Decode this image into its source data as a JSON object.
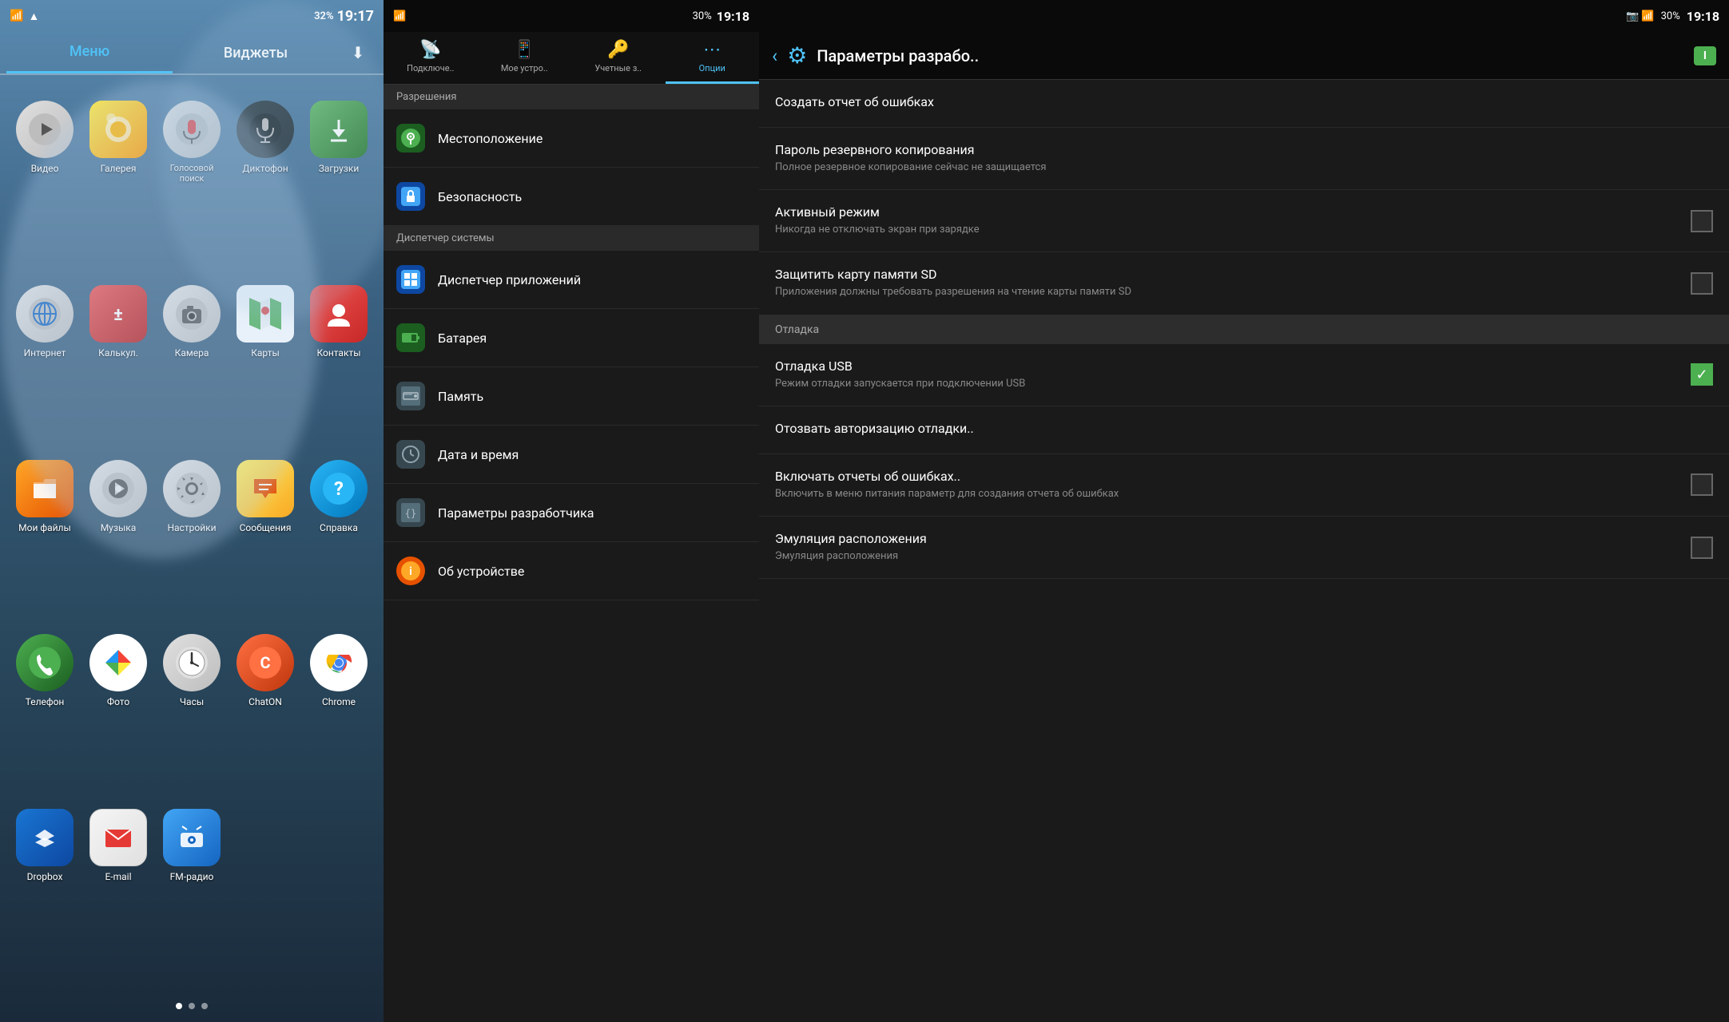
{
  "home": {
    "status_bar": {
      "left": "📶",
      "battery": "32%",
      "time": "19:17"
    },
    "tabs": [
      {
        "label": "Меню",
        "active": true
      },
      {
        "label": "Виджеты",
        "active": false
      }
    ],
    "download_icon": "⬇",
    "apps": [
      {
        "id": "video",
        "label": "Видео",
        "icon": "▶",
        "color": "#bdbdbd",
        "text_color": "#333"
      },
      {
        "id": "gallery",
        "label": "Галерея",
        "icon": "🌼",
        "color": "#ff9800"
      },
      {
        "id": "voice",
        "label": "Голосовой поиск",
        "icon": "🎤",
        "color": "#bdbdbd",
        "text_color": "#333"
      },
      {
        "id": "dictophone",
        "label": "Диктофон",
        "icon": "🎙",
        "color": "#37474f"
      },
      {
        "id": "downloads",
        "label": "Загрузки",
        "icon": "⬇",
        "color": "#4caf50"
      },
      {
        "id": "internet",
        "label": "Интернет",
        "icon": "🌐",
        "color": "#bdbdbd"
      },
      {
        "id": "calc",
        "label": "Калькул.",
        "icon": "±",
        "color": "#ef5350"
      },
      {
        "id": "camera",
        "label": "Камера",
        "icon": "📷",
        "color": "#bdbdbd"
      },
      {
        "id": "maps",
        "label": "Карты",
        "icon": "🗺",
        "color": "transparent"
      },
      {
        "id": "contacts",
        "label": "Контакты",
        "icon": "👤",
        "color": "#ef5350"
      },
      {
        "id": "myfiles",
        "label": "Мои файлы",
        "icon": "📁",
        "color": "#ffa726"
      },
      {
        "id": "music",
        "label": "Музыка",
        "icon": "▶",
        "color": "#bdbdbd"
      },
      {
        "id": "settings",
        "label": "Настройки",
        "icon": "⚙",
        "color": "#bdbdbd"
      },
      {
        "id": "messages",
        "label": "Сообщения",
        "icon": "✉",
        "color": "#ffeb3b",
        "text_color": "#333"
      },
      {
        "id": "help",
        "label": "Справка",
        "icon": "?",
        "color": "#29b6f6"
      },
      {
        "id": "phone",
        "label": "Телефон",
        "icon": "📞",
        "color": "#4caf50"
      },
      {
        "id": "photos",
        "label": "Фото",
        "icon": "◑",
        "color": "transparent"
      },
      {
        "id": "clock",
        "label": "Часы",
        "icon": "🕐",
        "color": "#bdbdbd"
      },
      {
        "id": "chaton",
        "label": "ChatON",
        "icon": "C",
        "color": "#ff7043"
      },
      {
        "id": "chrome",
        "label": "Chrome",
        "icon": "◎",
        "color": "transparent"
      },
      {
        "id": "dropbox",
        "label": "Dropbox",
        "icon": "📦",
        "color": "#1565c0"
      },
      {
        "id": "email",
        "label": "E-mail",
        "icon": "@",
        "color": "#e0e0e0",
        "text_color": "#c62828"
      },
      {
        "id": "fmradio",
        "label": "FM-радио",
        "icon": "📻",
        "color": "#1976d2"
      }
    ],
    "dots": [
      true,
      false,
      false
    ]
  },
  "settings": {
    "status_bar": {
      "time": "19:18",
      "battery": "30%"
    },
    "tabs": [
      {
        "label": "Подключе..",
        "icon": "📡",
        "active": false
      },
      {
        "label": "Мое устро..",
        "icon": "📱",
        "active": false
      },
      {
        "label": "Учетные з..",
        "icon": "🔑",
        "active": false
      },
      {
        "label": "Опции",
        "icon": "⋯",
        "active": true
      }
    ],
    "section_header": "Разрешения",
    "items": [
      {
        "label": "Местоположение",
        "icon": "📍",
        "icon_color": "#4caf50"
      },
      {
        "label": "Безопасность",
        "icon": "🔒",
        "icon_color": "#42a5f5"
      },
      {
        "label": "Диспетчер системы",
        "icon": "",
        "is_header": true
      },
      {
        "label": "Диспетчер приложений",
        "icon": "⊞",
        "icon_color": "#42a5f5"
      },
      {
        "label": "Батарея",
        "icon": "🔋",
        "icon_color": "#4caf50"
      },
      {
        "label": "Память",
        "icon": "💾",
        "icon_color": "#78909c"
      },
      {
        "label": "Дата и время",
        "icon": "🕐",
        "icon_color": "#78909c"
      },
      {
        "label": "Параметры разработчика",
        "icon": "{}",
        "icon_color": "#78909c"
      },
      {
        "label": "Об устройстве",
        "icon": "ℹ",
        "icon_color": "#ffa726"
      }
    ]
  },
  "developer": {
    "status_bar": {
      "time": "19:18",
      "battery": "30%"
    },
    "header": {
      "title": "Параметры разрабо..",
      "battery_label": "I",
      "back_icon": "‹"
    },
    "items": [
      {
        "title": "Создать отчет об ошибках",
        "subtitle": "",
        "has_checkbox": false,
        "checked": false,
        "is_section": false
      },
      {
        "title": "Пароль резервного копирования",
        "subtitle": "Полное резервное копирование сейчас не защищается",
        "has_checkbox": false,
        "checked": false,
        "is_section": false
      },
      {
        "title": "Активный режим",
        "subtitle": "Никогда не отключать экран при зарядке",
        "has_checkbox": true,
        "checked": false,
        "is_section": false
      },
      {
        "title": "Защитить карту памяти SD",
        "subtitle": "Приложения должны требовать разрешения на чтение карты памяти SD",
        "has_checkbox": true,
        "checked": false,
        "is_section": false
      },
      {
        "title": "Отладка",
        "subtitle": "",
        "has_checkbox": false,
        "checked": false,
        "is_section": true
      },
      {
        "title": "Отладка USB",
        "subtitle": "Режим отладки запускается при подключении USB",
        "has_checkbox": true,
        "checked": true,
        "is_section": false
      },
      {
        "title": "Отозвать авторизацию отладки..",
        "subtitle": "",
        "has_checkbox": false,
        "checked": false,
        "is_section": false
      },
      {
        "title": "Включать отчеты об ошибках..",
        "subtitle": "Включить в меню питания параметр для создания отчета об ошибках",
        "has_checkbox": true,
        "checked": false,
        "is_section": false
      },
      {
        "title": "Эмуляция расположения",
        "subtitle": "Эмуляция расположения",
        "has_checkbox": true,
        "checked": false,
        "is_section": false
      }
    ]
  }
}
